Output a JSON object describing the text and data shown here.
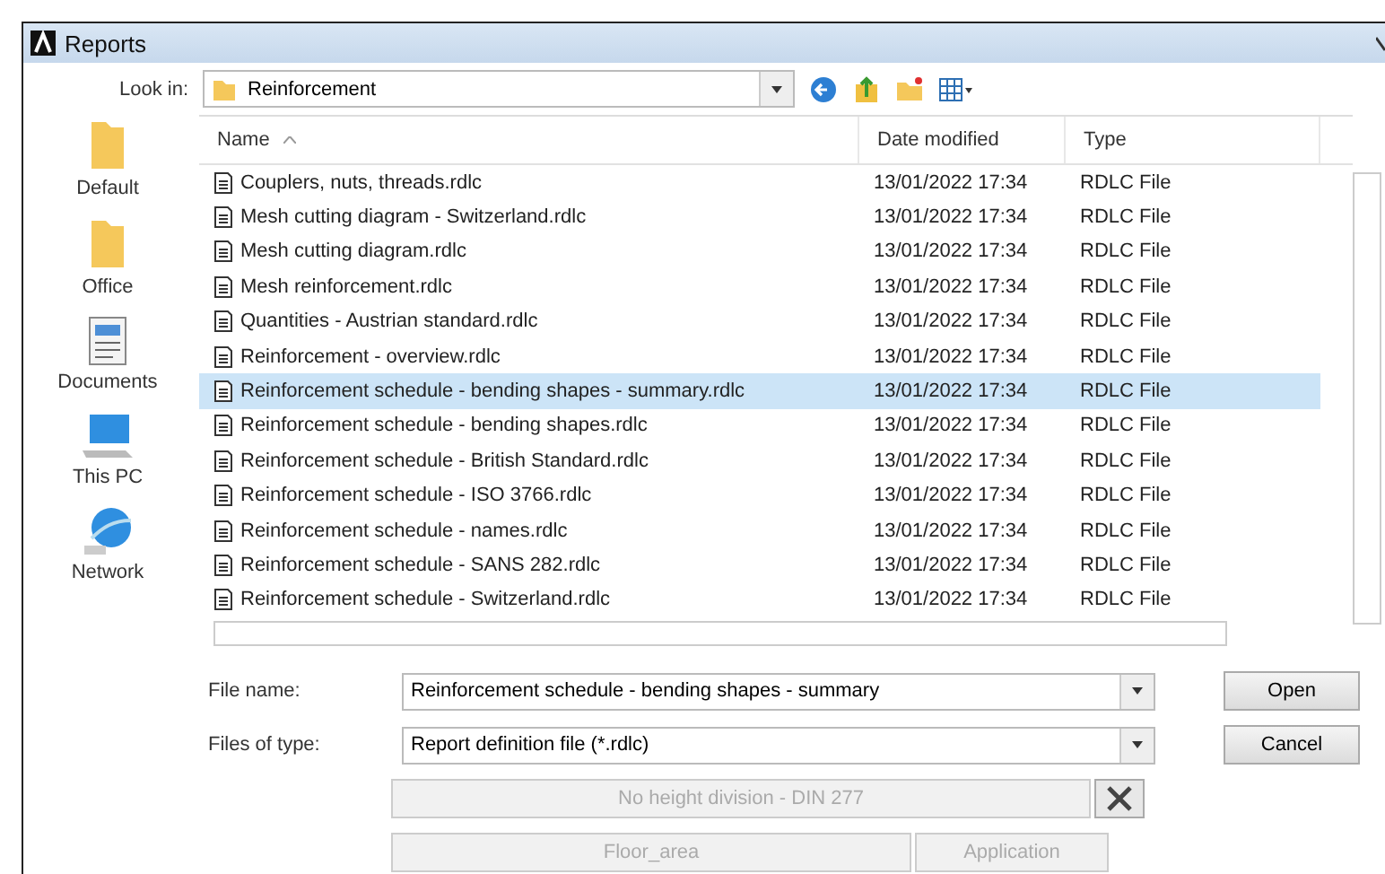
{
  "window": {
    "title": "Reports"
  },
  "look_in": {
    "label": "Look in:",
    "value": "Reinforcement"
  },
  "places": [
    {
      "label": "Default",
      "kind": "folder"
    },
    {
      "label": "Office",
      "kind": "folder"
    },
    {
      "label": "Documents",
      "kind": "documents"
    },
    {
      "label": "This PC",
      "kind": "computer"
    },
    {
      "label": "Network",
      "kind": "network"
    }
  ],
  "table": {
    "columns": [
      "Name",
      "Date modified",
      "Type"
    ],
    "rows": [
      {
        "name": "Couplers, nuts, threads.rdlc",
        "date": "13/01/2022 17:34",
        "type": "RDLC File",
        "selected": false
      },
      {
        "name": "Mesh cutting diagram - Switzerland.rdlc",
        "date": "13/01/2022 17:34",
        "type": "RDLC File",
        "selected": false
      },
      {
        "name": "Mesh cutting diagram.rdlc",
        "date": "13/01/2022 17:34",
        "type": "RDLC File",
        "selected": false
      },
      {
        "name": "Mesh reinforcement.rdlc",
        "date": "13/01/2022 17:34",
        "type": "RDLC File",
        "selected": false
      },
      {
        "name": "Quantities - Austrian standard.rdlc",
        "date": "13/01/2022 17:34",
        "type": "RDLC File",
        "selected": false
      },
      {
        "name": "Reinforcement - overview.rdlc",
        "date": "13/01/2022 17:34",
        "type": "RDLC File",
        "selected": false
      },
      {
        "name": "Reinforcement schedule - bending shapes - summary.rdlc",
        "date": "13/01/2022 17:34",
        "type": "RDLC File",
        "selected": true
      },
      {
        "name": "Reinforcement schedule - bending shapes.rdlc",
        "date": "13/01/2022 17:34",
        "type": "RDLC File",
        "selected": false
      },
      {
        "name": "Reinforcement schedule - British Standard.rdlc",
        "date": "13/01/2022 17:34",
        "type": "RDLC File",
        "selected": false
      },
      {
        "name": "Reinforcement schedule - ISO 3766.rdlc",
        "date": "13/01/2022 17:34",
        "type": "RDLC File",
        "selected": false
      },
      {
        "name": "Reinforcement schedule - names.rdlc",
        "date": "13/01/2022 17:34",
        "type": "RDLC File",
        "selected": false
      },
      {
        "name": "Reinforcement schedule - SANS 282.rdlc",
        "date": "13/01/2022 17:34",
        "type": "RDLC File",
        "selected": false
      },
      {
        "name": "Reinforcement schedule - Switzerland.rdlc",
        "date": "13/01/2022 17:34",
        "type": "RDLC File",
        "selected": false
      }
    ]
  },
  "file_name": {
    "label": "File name:",
    "value": "Reinforcement schedule - bending shapes - summary"
  },
  "file_type": {
    "label": "Files of type:",
    "value": "Report definition file (*.rdlc)"
  },
  "buttons": [
    "Open",
    "Cancel"
  ],
  "layout_button": {
    "label": "No height division - DIN 277",
    "disabled": true
  },
  "area_button": {
    "label": "Floor_area",
    "disabled": true
  },
  "application_button": {
    "label": "Application",
    "disabled": true
  }
}
